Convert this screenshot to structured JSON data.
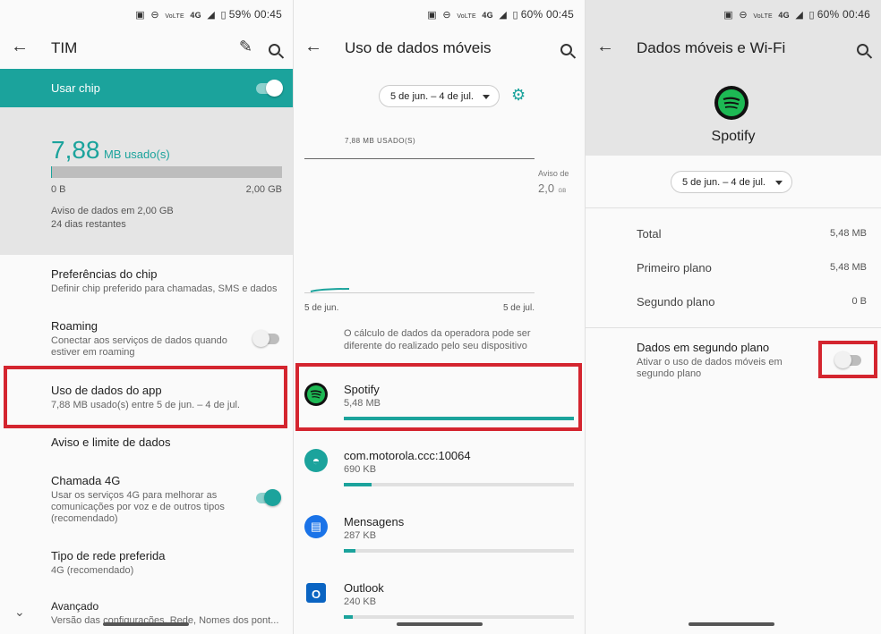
{
  "colors": {
    "accent": "#1ba39c",
    "highlight": "#d4252f",
    "spotify": "#1db954"
  },
  "panel1": {
    "status": {
      "battery": "59%",
      "time": "00:45",
      "network": "4G",
      "volte": "VoLTE"
    },
    "appbar": {
      "title": "TIM",
      "edit_icon": "pencil-icon",
      "search_icon": "search-icon"
    },
    "chip_toggle": {
      "label": "Usar chip",
      "on": true
    },
    "usage": {
      "amount": "7,88",
      "unit": "MB usado(s)",
      "min_label": "0 B",
      "max_label": "2,00 GB",
      "fill_fraction": 0.004,
      "warning": "Aviso de dados em 2,00 GB",
      "days_left": "24 dias restantes"
    },
    "items": [
      {
        "title": "Preferências do chip",
        "subtitle": "Definir chip preferido para chamadas, SMS e dados"
      },
      {
        "title": "Roaming",
        "subtitle": "Conectar aos serviços de dados quando estiver em roaming",
        "toggle_on": false
      },
      {
        "title": "Uso de dados do app",
        "subtitle": "7,88 MB usado(s) entre 5 de jun. – 4 de jul."
      },
      {
        "title": "Aviso e limite de dados",
        "subtitle": ""
      },
      {
        "title": "Chamada 4G",
        "subtitle": "Usar os serviços 4G para melhorar as comunicações por voz e de outros tipos (recomendado)",
        "toggle_on": true
      },
      {
        "title": "Tipo de rede preferida",
        "subtitle": "4G (recomendado)"
      },
      {
        "title": "Avançado",
        "subtitle": "Versão das configurações, Rede, Nomes dos pont..."
      }
    ]
  },
  "panel2": {
    "status": {
      "battery": "60%",
      "time": "00:45",
      "network": "4G",
      "volte": "VoLTE"
    },
    "appbar": {
      "title": "Uso de dados móveis",
      "search_icon": "search-icon"
    },
    "date_range": "5 de jun. – 4 de jul.",
    "chart": {
      "used_label": "7,88 MB USADO(S)",
      "warn_label": "Aviso de",
      "warn_value": "2,0",
      "warn_unit": "GB",
      "x_start": "5 de jun.",
      "x_end": "5 de jul."
    },
    "note": "O cálculo de dados da operadora pode ser diferente do realizado pelo seu dispositivo",
    "apps": [
      {
        "name": "Spotify",
        "size": "5,48 MB",
        "fraction": 1.0,
        "icon": "spotify-icon"
      },
      {
        "name": "com.motorola.ccc:10064",
        "size": "690 KB",
        "fraction": 0.12,
        "icon": "android-icon"
      },
      {
        "name": "Mensagens",
        "size": "287 KB",
        "fraction": 0.05,
        "icon": "messages-icon"
      },
      {
        "name": "Outlook",
        "size": "240 KB",
        "fraction": 0.04,
        "icon": "outlook-icon"
      }
    ]
  },
  "panel3": {
    "status": {
      "battery": "60%",
      "time": "00:46",
      "network": "4G",
      "volte": "VoLTE"
    },
    "appbar": {
      "title": "Dados móveis e Wi-Fi",
      "search_icon": "search-icon"
    },
    "app_name": "Spotify",
    "date_range": "5 de jun. – 4 de jul.",
    "stats": [
      {
        "label": "Total",
        "value": "5,48 MB"
      },
      {
        "label": "Primeiro plano",
        "value": "5,48 MB"
      },
      {
        "label": "Segundo plano",
        "value": "0 B"
      }
    ],
    "background_data": {
      "title": "Dados em segundo plano",
      "subtitle": "Ativar o uso de dados móveis em segundo plano",
      "on": false
    }
  }
}
